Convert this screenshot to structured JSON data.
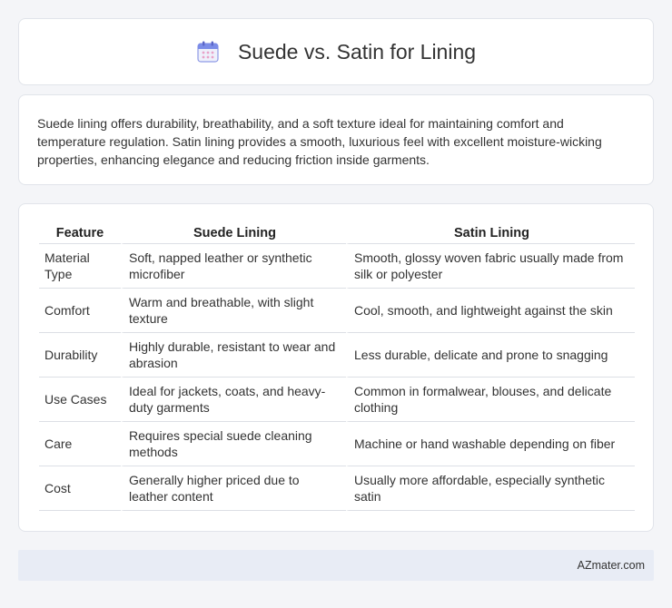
{
  "header": {
    "title": "Suede vs. Satin for Lining",
    "icon": "calendar-icon"
  },
  "intro": {
    "text": "Suede lining offers durability, breathability, and a soft texture ideal for maintaining comfort and temperature regulation. Satin lining provides a smooth, luxurious feel with excellent moisture-wicking properties, enhancing elegance and reducing friction inside garments."
  },
  "table": {
    "headers": [
      "Feature",
      "Suede Lining",
      "Satin Lining"
    ],
    "rows": [
      [
        "Material Type",
        "Soft, napped leather or synthetic microfiber",
        "Smooth, glossy woven fabric usually made from silk or polyester"
      ],
      [
        "Comfort",
        "Warm and breathable, with slight texture",
        "Cool, smooth, and lightweight against the skin"
      ],
      [
        "Durability",
        "Highly durable, resistant to wear and abrasion",
        "Less durable, delicate and prone to snagging"
      ],
      [
        "Use Cases",
        "Ideal for jackets, coats, and heavy-duty garments",
        "Common in formalwear, blouses, and delicate clothing"
      ],
      [
        "Care",
        "Requires special suede cleaning methods",
        "Machine or hand washable depending on fiber"
      ],
      [
        "Cost",
        "Generally higher priced due to leather content",
        "Usually more affordable, especially synthetic satin"
      ]
    ]
  },
  "footer": {
    "text": "AZmater.com"
  }
}
